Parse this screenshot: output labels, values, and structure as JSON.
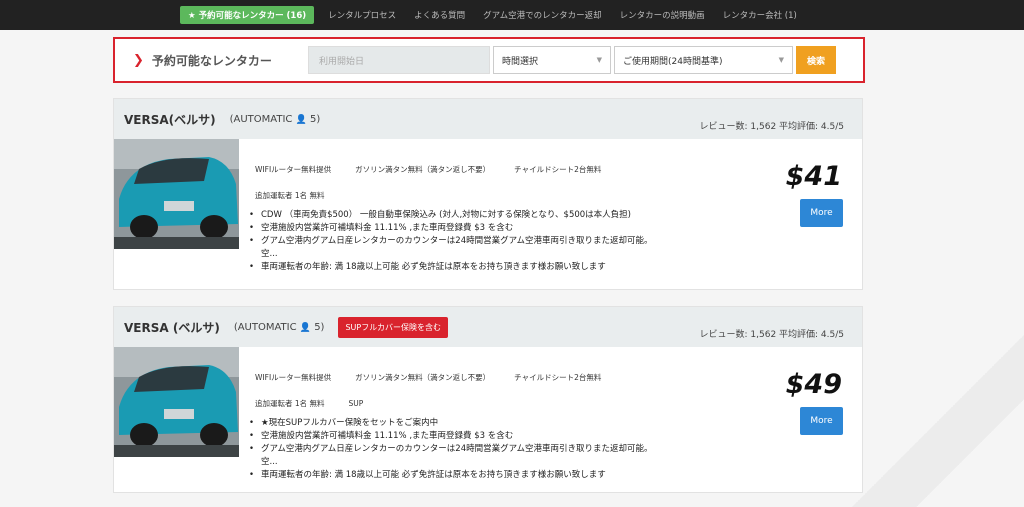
{
  "nav": {
    "active": "★ 予約可能なレンタカー (16)",
    "items": [
      "レンタルプロセス",
      "よくある質問",
      "グアム空港でのレンタカー返却",
      "レンタカーの説明動画",
      "レンタカー会社 (1)"
    ]
  },
  "search": {
    "title": "予約可能なレンタカー",
    "date_placeholder": "利用開始日",
    "time_select": "時間選択",
    "period_select": "ご使用期間(24時間基準)",
    "button": "検索"
  },
  "cars": [
    {
      "name": "VERSA(ベルサ)",
      "transmission": "(AUTOMATIC",
      "seats": "5)",
      "badge": "",
      "review": "レビュー数: 1,562 平均評価: 4.5/5",
      "features": [
        "WIFIルーター無料提供",
        "ガソリン満タン無料（満タン返し不要）",
        "チャイルドシート2台無料",
        "追加運転者 1名 無料"
      ],
      "bullets": [
        "CDW （車両免責$500） 一般自動車保険込み (対人,対物に対する保険となり、$500は本人負担)",
        "空港施設内営業許可補填料金 11.11% ,また車両登録費 $3 を含む",
        "グアム空港内グアム日産レンタカーのカウンターは24時間営業グアム空港車両引き取りまた返却可能。空...",
        "車両運転者の年齢: 満 18歳以上可能 必ず免許証は原本をお持ち頂きます様お願い致します"
      ],
      "price": "$41",
      "more": "More"
    },
    {
      "name": "VERSA (ベルサ)",
      "transmission": "(AUTOMATIC",
      "seats": "5)",
      "badge": "SUPフルカバー保険を含む",
      "review": "レビュー数: 1,562 平均評価: 4.5/5",
      "features": [
        "WIFIルーター無料提供",
        "ガソリン満タン無料（満タン返し不要）",
        "チャイルドシート2台無料",
        "追加運転者 1名 無料",
        "SUP"
      ],
      "bullets": [
        "★現在SUPフルカバー保険をセットをご案内中",
        "空港施設内営業許可補填料金 11.11% ,また車両登録費 $3 を含む",
        "グアム空港内グアム日産レンタカーのカウンターは24時間営業グアム空港車両引き取りまた返却可能。空...",
        "車両運転者の年齢: 満 18歳以上可能 必ず免許証は原本をお持ち頂きます様お願い致します"
      ],
      "price": "$49",
      "more": "More"
    }
  ]
}
